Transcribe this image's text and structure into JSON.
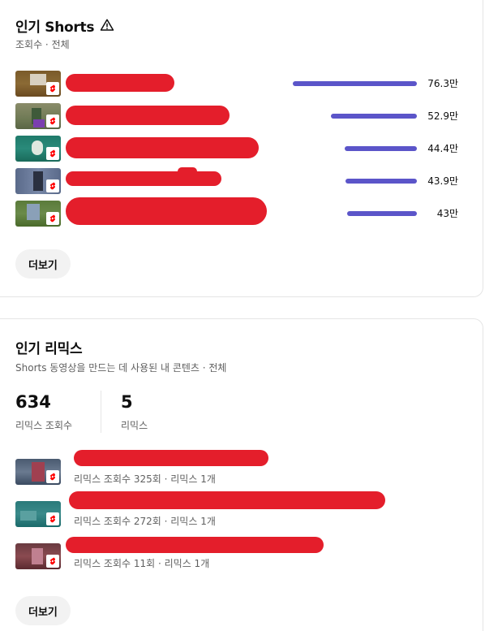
{
  "popular_shorts": {
    "title": "인기 Shorts",
    "subtitle": "조회수 · 전체",
    "info_icon": "warning-triangle-icon",
    "items": [
      {
        "value_label": "76.3만",
        "value": 763000
      },
      {
        "value_label": "52.9만",
        "value": 529000
      },
      {
        "value_label": "44.4만",
        "value": 444000
      },
      {
        "value_label": "43.9만",
        "value": 439000
      },
      {
        "value_label": "43만",
        "value": 430000
      }
    ],
    "more_label": "더보기",
    "bar_color": "#5b55c9"
  },
  "popular_remix": {
    "title": "인기 리믹스",
    "subtitle": "Shorts 동영상을 만드는 데 사용된 내 콘텐츠 · 전체",
    "stats": [
      {
        "value": "634",
        "label": "리믹스 조회수"
      },
      {
        "value": "5",
        "label": "리믹스"
      }
    ],
    "items": [
      {
        "meta": "리믹스 조회수 325회 · 리믹스 1개"
      },
      {
        "meta": "리믹스 조회수 272회 · 리믹스 1개"
      },
      {
        "meta": "리믹스 조회수 11회 · 리믹스 1개"
      }
    ],
    "more_label": "더보기"
  }
}
